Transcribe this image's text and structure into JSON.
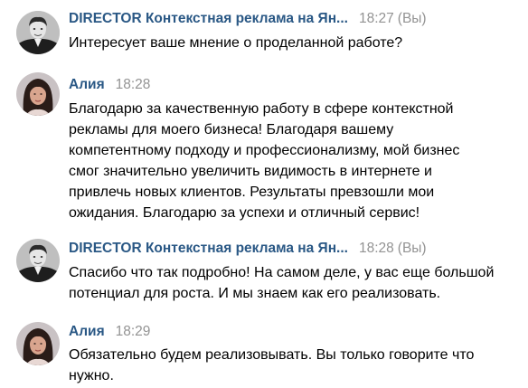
{
  "messages": [
    {
      "author": "DIRECTOR Контекстная реклама на Ян...",
      "time": "18:27",
      "you_label": "(Вы)",
      "text": "Интересует ваше мнение о проделанной работе?"
    },
    {
      "author": "Алия",
      "time": "18:28",
      "text": "Благодарю за качественную работу в сфере контекстной\nрекламы для моего бизнеса! Благодаря вашему\nкомпетентному подходу и профессионализму, мой бизнес\nсмог значительно увеличить видимость в интернете и\nпривлечь новых клиентов. Результаты превзошли мои\nожидания. Благодарю за успехи и отличный сервис!"
    },
    {
      "author": "DIRECTOR Контекстная реклама на Ян...",
      "time": "18:28",
      "you_label": "(Вы)",
      "text": "Спасибо что так подробно! На самом деле, у вас еще большой\nпотенциал для роста. И мы знаем как его реализовать."
    },
    {
      "author": "Алия",
      "time": "18:29",
      "text": "Обязательно будем реализовывать. Вы только говорите что\nнужно."
    }
  ],
  "colors": {
    "author": "#2a5885",
    "time": "#939393",
    "text": "#000000"
  }
}
